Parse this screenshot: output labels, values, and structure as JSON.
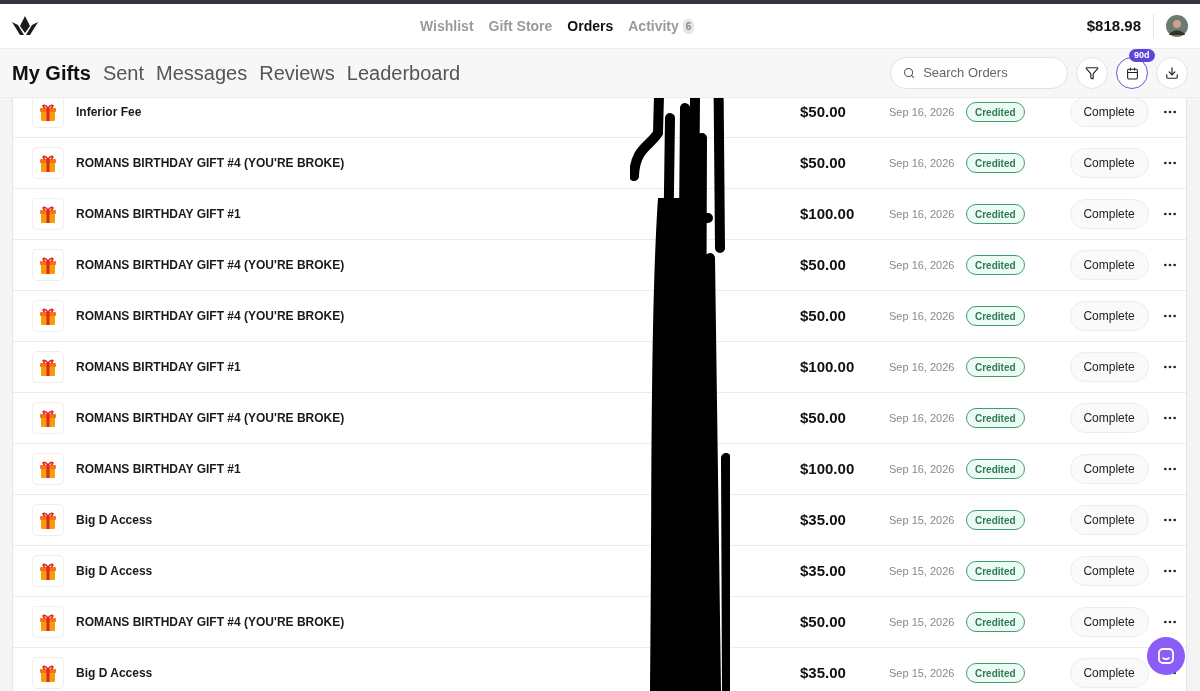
{
  "top_nav": [
    {
      "label": "Wishlist",
      "selected": false
    },
    {
      "label": "Gift Store",
      "selected": false
    },
    {
      "label": "Orders",
      "selected": true
    },
    {
      "label": "Activity",
      "selected": false,
      "badge": "6"
    }
  ],
  "balance": "$818.98",
  "tabs": [
    {
      "label": "My Gifts",
      "selected": true
    },
    {
      "label": "Sent",
      "selected": false
    },
    {
      "label": "Messages",
      "selected": false
    },
    {
      "label": "Reviews",
      "selected": false
    },
    {
      "label": "Leaderboard",
      "selected": false
    }
  ],
  "search": {
    "placeholder": "Search Orders"
  },
  "date_filter": {
    "badge": "90d",
    "selected": true
  },
  "orders": [
    {
      "title": "Inferior Fee",
      "amount": "$50.00",
      "date": "Sep 16, 2026",
      "status": "Credited",
      "action": "Complete"
    },
    {
      "title": "ROMANS BIRTHDAY GIFT #4 (YOU'RE BROKE)",
      "amount": "$50.00",
      "date": "Sep 16, 2026",
      "status": "Credited",
      "action": "Complete"
    },
    {
      "title": "ROMANS BIRTHDAY GIFT #1",
      "amount": "$100.00",
      "date": "Sep 16, 2026",
      "status": "Credited",
      "action": "Complete"
    },
    {
      "title": "ROMANS BIRTHDAY GIFT #4 (YOU'RE BROKE)",
      "amount": "$50.00",
      "date": "Sep 16, 2026",
      "status": "Credited",
      "action": "Complete"
    },
    {
      "title": "ROMANS BIRTHDAY GIFT #4 (YOU'RE BROKE)",
      "amount": "$50.00",
      "date": "Sep 16, 2026",
      "status": "Credited",
      "action": "Complete"
    },
    {
      "title": "ROMANS BIRTHDAY GIFT #1",
      "amount": "$100.00",
      "date": "Sep 16, 2026",
      "status": "Credited",
      "action": "Complete"
    },
    {
      "title": "ROMANS BIRTHDAY GIFT #4 (YOU'RE BROKE)",
      "amount": "$50.00",
      "date": "Sep 16, 2026",
      "status": "Credited",
      "action": "Complete"
    },
    {
      "title": "ROMANS BIRTHDAY GIFT #1",
      "amount": "$100.00",
      "date": "Sep 16, 2026",
      "status": "Credited",
      "action": "Complete"
    },
    {
      "title": "Big D Access",
      "amount": "$35.00",
      "date": "Sep 15, 2026",
      "status": "Credited",
      "action": "Complete"
    },
    {
      "title": "Big D Access",
      "amount": "$35.00",
      "date": "Sep 15, 2026",
      "status": "Credited",
      "action": "Complete"
    },
    {
      "title": "ROMANS BIRTHDAY GIFT #4 (YOU'RE BROKE)",
      "amount": "$50.00",
      "date": "Sep 15, 2026",
      "status": "Credited",
      "action": "Complete"
    },
    {
      "title": "Big D Access",
      "amount": "$35.00",
      "date": "Sep 15, 2026",
      "status": "Credited",
      "action": "Complete"
    }
  ]
}
